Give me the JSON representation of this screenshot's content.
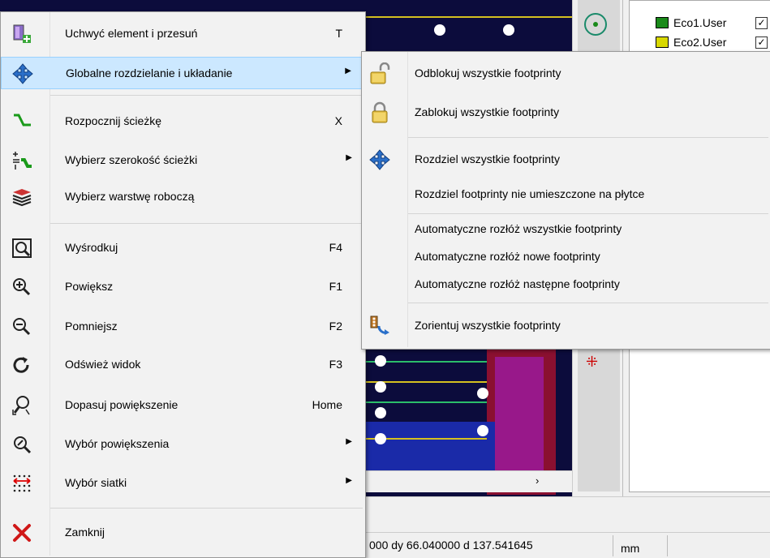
{
  "layers": [
    {
      "name": "Eco1.User",
      "color": "#1a8a1a",
      "checked": "✓"
    },
    {
      "name": "Eco2.User",
      "color": "#d8d800",
      "checked": "✓"
    }
  ],
  "status": {
    "coords": "000  dy 66.040000  d 137.541645",
    "unit": "mm"
  },
  "menu": {
    "items": [
      {
        "label": "Uchwyć element i przesuń",
        "shortcut": "T",
        "icon": "grab-move-icon"
      },
      {
        "label": "Globalne rozdzielanie i układanie",
        "shortcut": "",
        "icon": "move-arrows-icon",
        "submenu": true
      },
      {
        "label": "Rozpocznij ścieżkę",
        "shortcut": "X",
        "icon": "route-track-icon"
      },
      {
        "label": "Wybierz szerokość ścieżki",
        "shortcut": "",
        "icon": "track-width-icon",
        "submenu": true
      },
      {
        "label": "Wybierz warstwę roboczą",
        "shortcut": "",
        "icon": "layers-icon"
      },
      {
        "label": "Wyśrodkuj",
        "shortcut": "F4",
        "icon": "center-view-icon"
      },
      {
        "label": "Powiększ",
        "shortcut": "F1",
        "icon": "zoom-in-icon"
      },
      {
        "label": "Pomniejsz",
        "shortcut": "F2",
        "icon": "zoom-out-icon"
      },
      {
        "label": "Odśwież widok",
        "shortcut": "F3",
        "icon": "refresh-icon"
      },
      {
        "label": "Dopasuj powiększenie",
        "shortcut": "Home",
        "icon": "zoom-fit-icon"
      },
      {
        "label": "Wybór powiększenia",
        "shortcut": "",
        "icon": "zoom-select-icon",
        "submenu": true
      },
      {
        "label": "Wybór siatki",
        "shortcut": "",
        "icon": "grid-icon",
        "submenu": true
      },
      {
        "label": "Zamknij",
        "shortcut": "",
        "icon": "close-icon"
      }
    ],
    "submenu_arrow": "▶"
  },
  "submenu": {
    "items": [
      {
        "label": "Odblokuj wszystkie footprinty",
        "icon": "unlock-icon"
      },
      {
        "label": "Zablokuj wszystkie footprinty",
        "icon": "lock-icon"
      },
      {
        "label": "Rozdziel wszystkie footprinty",
        "icon": "move-arrows-icon"
      },
      {
        "label": "Rozdziel footprinty nie umieszczone na płytce",
        "icon": ""
      },
      {
        "label": "Automatyczne rozłóż wszystkie footprinty",
        "icon": ""
      },
      {
        "label": "Automatyczne rozłóż nowe footprinty",
        "icon": ""
      },
      {
        "label": "Automatyczne rozłóż następne footprinty",
        "icon": ""
      },
      {
        "label": "Zorientuj wszystkie footprinty",
        "icon": "orient-icon"
      }
    ]
  },
  "colors": {
    "highlight": "#cce8ff",
    "pcb_bg": "#0c0c3c"
  }
}
